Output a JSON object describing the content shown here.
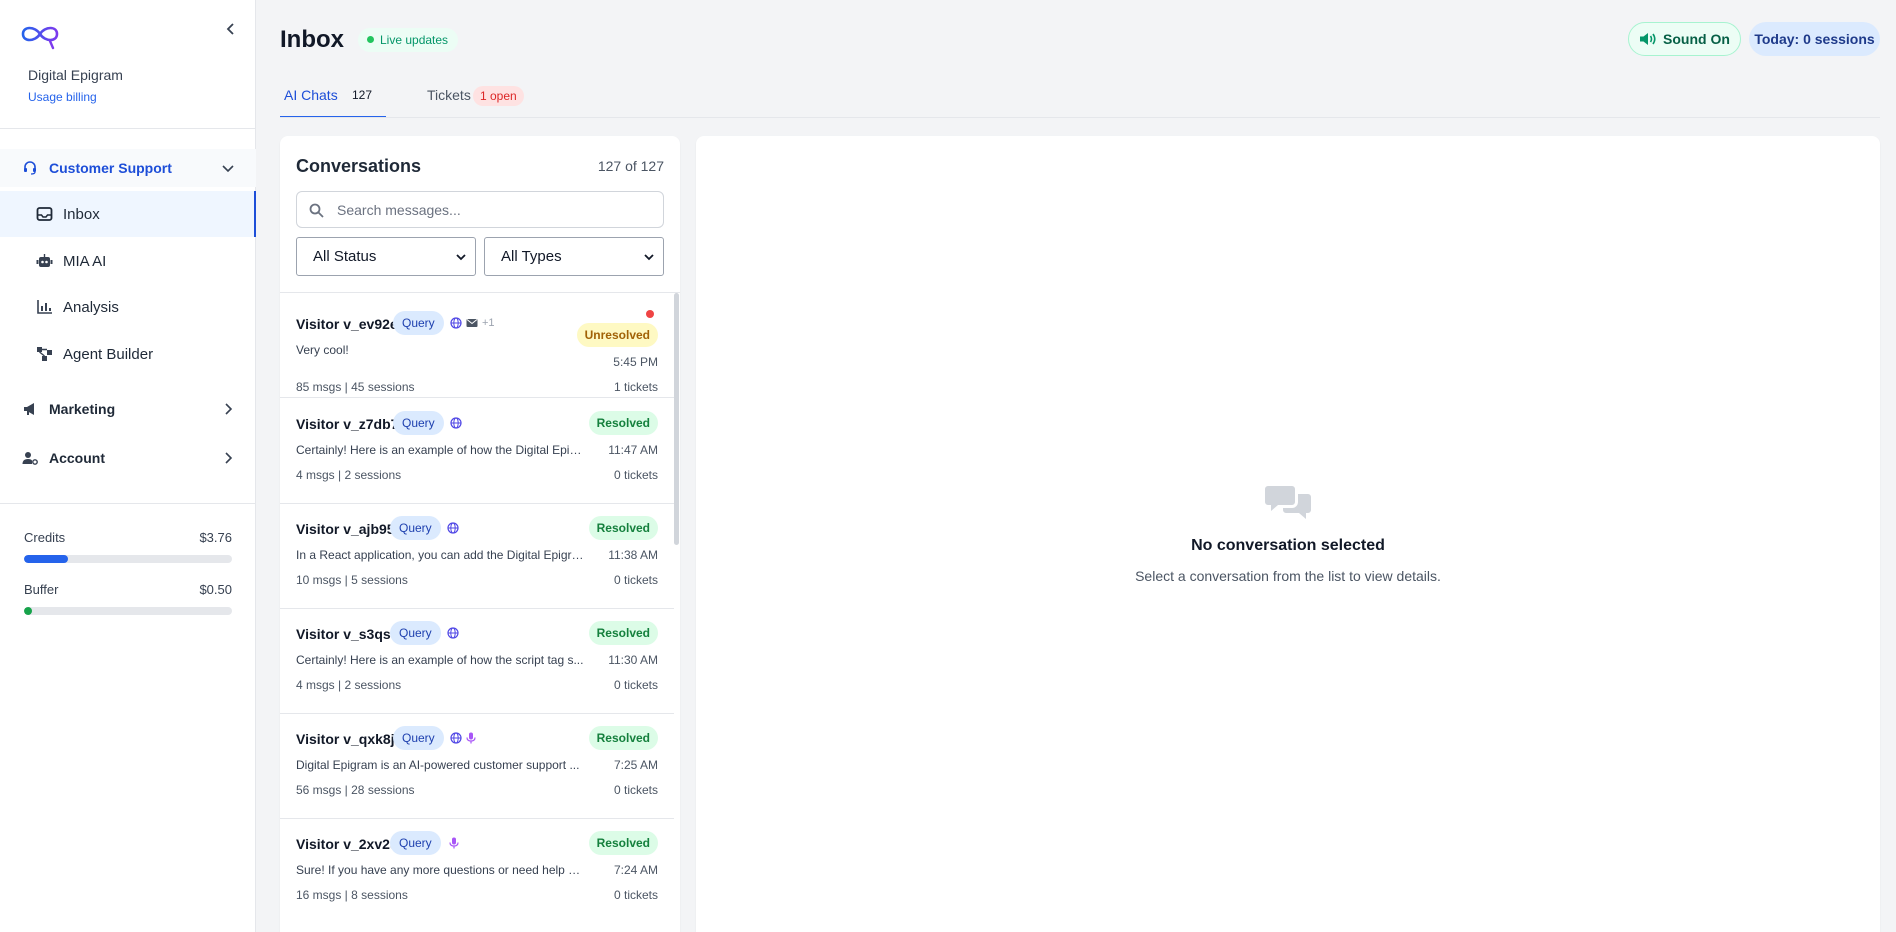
{
  "sidebar": {
    "org_name": "Digital Epigram",
    "billing_link": "Usage billing",
    "groups": [
      {
        "label": "Customer Support",
        "expanded": true
      },
      {
        "label": "Marketing",
        "expanded": false
      },
      {
        "label": "Account",
        "expanded": false
      }
    ],
    "support_items": [
      {
        "label": "Inbox",
        "icon": "inbox-icon",
        "active": true
      },
      {
        "label": "MIA AI",
        "icon": "robot-icon"
      },
      {
        "label": "Analysis",
        "icon": "chart-icon"
      },
      {
        "label": "Agent Builder",
        "icon": "workflow-icon"
      }
    ],
    "credits": {
      "label": "Credits",
      "value": "$3.76",
      "fill_pct": 21,
      "color": "#2563eb"
    },
    "buffer": {
      "label": "Buffer",
      "value": "$0.50",
      "fill_pct": 4,
      "color": "#16a34a"
    }
  },
  "header": {
    "title": "Inbox",
    "live_badge": "Live updates",
    "sound_button": "Sound On",
    "today_button": "Today: 0 sessions"
  },
  "tabs": [
    {
      "label": "AI Chats",
      "count": "127",
      "active": true
    },
    {
      "label": "Tickets",
      "badge": "1 open"
    }
  ],
  "conversations": {
    "title": "Conversations",
    "count_text": "127 of 127",
    "search_placeholder": "Search messages...",
    "filter_status": "All Status",
    "filter_type": "All Types",
    "items": [
      {
        "visitor": "Visitor v_ev92eg",
        "badge": "Query",
        "channels": [
          "globe-icon",
          "mail-icon"
        ],
        "more": "+1",
        "status": "Unresolved",
        "unread": true,
        "preview": "Very cool!",
        "time": "5:45 PM",
        "meta": "85 msgs | 45 sessions",
        "tickets": "1 tickets"
      },
      {
        "visitor": "Visitor v_z7db74",
        "badge": "Query",
        "channels": [
          "globe-icon"
        ],
        "status": "Resolved",
        "preview": "Certainly! Here is an example of how the Digital Epig...",
        "time": "11:47 AM",
        "meta": "4 msgs | 2 sessions",
        "tickets": "0 tickets"
      },
      {
        "visitor": "Visitor v_ajb95p",
        "badge": "Query",
        "channels": [
          "globe-icon"
        ],
        "status": "Resolved",
        "preview": "In a React application, you can add the Digital Epigra...",
        "time": "11:38 AM",
        "meta": "10 msgs | 5 sessions",
        "tickets": "0 tickets"
      },
      {
        "visitor": "Visitor v_s3qs8a",
        "badge": "Query",
        "channels": [
          "globe-icon"
        ],
        "status": "Resolved",
        "preview": "Certainly! Here is an example of how the script tag s...",
        "time": "11:30 AM",
        "meta": "4 msgs | 2 sessions",
        "tickets": "0 tickets"
      },
      {
        "visitor": "Visitor v_qxk8jm",
        "badge": "Query",
        "channels": [
          "globe-icon",
          "mic-icon"
        ],
        "status": "Resolved",
        "preview": "Digital Epigram is an AI-powered customer support ...",
        "time": "7:25 AM",
        "meta": "56 msgs | 28 sessions",
        "tickets": "0 tickets"
      },
      {
        "visitor": "Visitor v_2xv2d8",
        "badge": "Query",
        "channels": [
          "mic-icon"
        ],
        "status": "Resolved",
        "preview": "Sure! If you have any more questions or need help w...",
        "time": "7:24 AM",
        "meta": "16 msgs | 8 sessions",
        "tickets": "0 tickets"
      }
    ]
  },
  "detail": {
    "empty_title": "No conversation selected",
    "empty_subtitle": "Select a conversation from the list to view details."
  }
}
